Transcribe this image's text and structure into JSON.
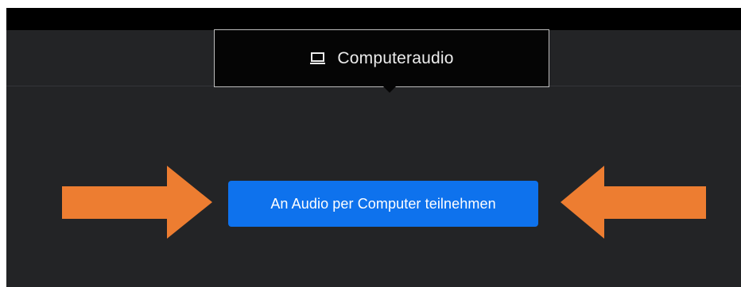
{
  "tooltip": {
    "icon": "laptop-icon",
    "label": "Computeraudio"
  },
  "join_button": {
    "label": "An Audio per Computer teilnehmen"
  },
  "annotations": {
    "arrow_color": "#ed7d31",
    "left_arrow": "arrow-right-icon",
    "right_arrow": "arrow-left-icon"
  },
  "colors": {
    "background": "#232426",
    "top_bar": "#000000",
    "tooltip_background": "#050505",
    "tooltip_border": "#bdbdbd",
    "button": "#0e72ed"
  }
}
